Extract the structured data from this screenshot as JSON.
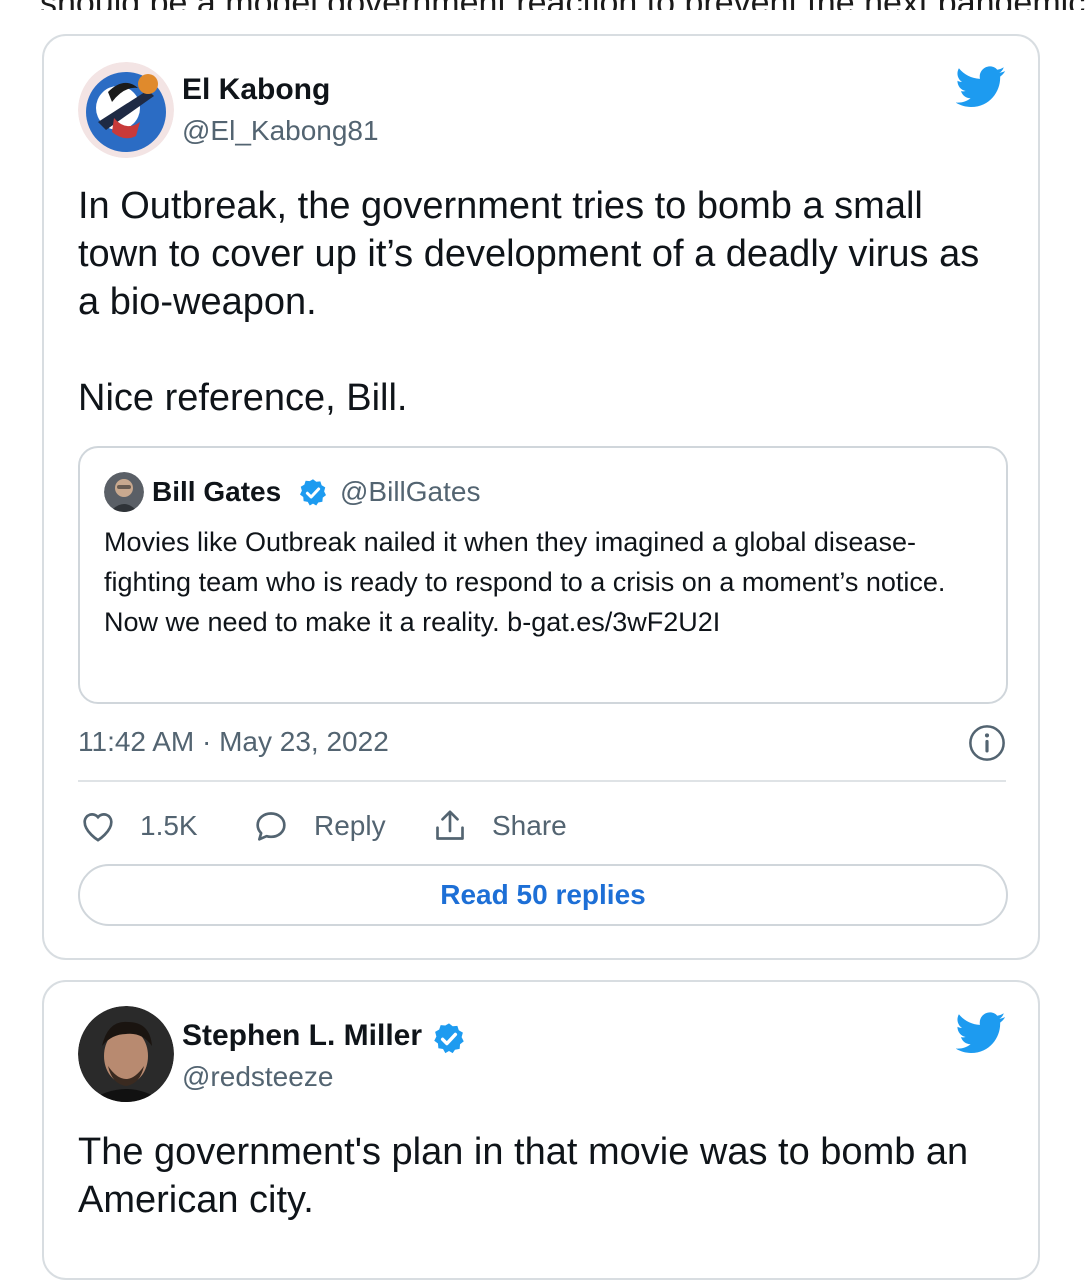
{
  "clipped_heading": "should be a model government reaction to prevent the next pandemic",
  "tweets": [
    {
      "display_name": "El Kabong",
      "handle": "@El_Kabong81",
      "text_lines": [
        "In Outbreak, the government tries to bomb a small town to cover up it’s development of a deadly virus as a bio-weapon.",
        "Nice reference, Bill."
      ],
      "quote": {
        "display_name": "Bill Gates",
        "handle": "@BillGates",
        "verified": true,
        "text": "Movies like Outbreak nailed it when they imagined a global disease-fighting team who is ready to respond to a crisis on a moment’s notice. Now we need to make it a reality. b-gat.es/3wF2U2I"
      },
      "timestamp": "11:42 AM · May 23, 2022",
      "likes": "1.5K",
      "reply_label": "Reply",
      "share_label": "Share",
      "read_replies_label": "Read 50 replies"
    },
    {
      "display_name": "Stephen L. Miller",
      "handle": "@redsteeze",
      "verified": true,
      "text": "The government's plan in that movie was to bomb an American city."
    }
  ],
  "icons": {
    "brand": "twitter-bird-icon",
    "like": "heart-icon",
    "reply": "speech-bubble-icon",
    "share": "share-upload-icon",
    "info": "info-icon",
    "verified": "verified-badge-icon"
  },
  "colors": {
    "twitter_blue": "#1d9bf0",
    "link_blue": "#1d6fd6",
    "secondary_text": "#536471",
    "border": "#d8dde1"
  }
}
